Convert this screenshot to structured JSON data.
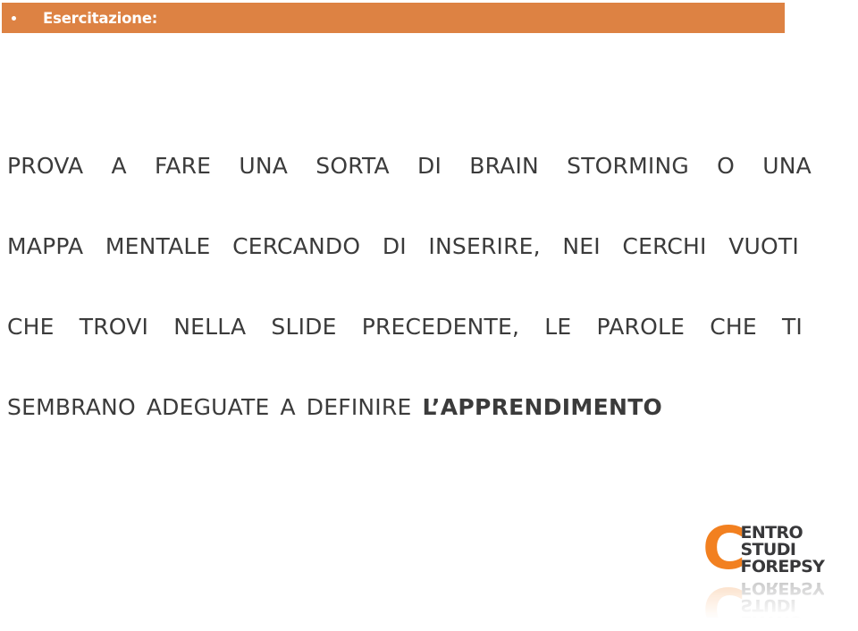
{
  "slide": {
    "title_bar": {
      "bullet": "bullet-dot",
      "title": "Esercitazione:",
      "background_color": "#dd8243",
      "text_color": "#ffffff"
    },
    "body": {
      "text_color": "#3b3b3b",
      "full_text": "PROVA A FARE UNA SORTA DI BRAIN STORMING O UNA MAPPA MENTALE CERCANDO DI INSERIRE, NEI CERCHI VUOTI CHE TROVI NELLA SLIDE PRECEDENTE, LE PAROLE CHE TI SEMBRANO ADEGUATE A DEFINIRE L’APPRENDIMENTO",
      "lines": [
        {
          "words": [
            "PROVA",
            "A",
            "FARE",
            "UNA",
            "SORTA",
            "DI",
            "BRAIN",
            "STORMING",
            "O",
            "UNA"
          ],
          "bold_words": []
        },
        {
          "words": [
            "MAPPA",
            "MENTALE",
            "CERCANDO",
            "DI",
            "INSERIRE,",
            "NEI",
            "CERCHI",
            "VUOTI"
          ],
          "bold_words": []
        },
        {
          "words": [
            "CHE",
            "TROVI",
            "NELLA",
            "SLIDE",
            "PRECEDENTE,",
            "LE",
            "PAROLE",
            "CHE",
            "TI"
          ],
          "bold_words": []
        },
        {
          "words": [
            "SEMBRANO",
            "ADEGUATE",
            "A",
            "DEFINIRE",
            "L’APPRENDIMENTO"
          ],
          "bold_words": [
            "L’APPRENDIMENTO"
          ]
        }
      ]
    },
    "logo": {
      "mark_letter": "C",
      "mark_color": "#f28020",
      "word_color": "#38383a",
      "lines": [
        "ENTRO",
        "STUDI",
        "FOREPSY"
      ],
      "full_name": "CENTRO STUDI FOREPSY",
      "has_reflection": true
    }
  }
}
